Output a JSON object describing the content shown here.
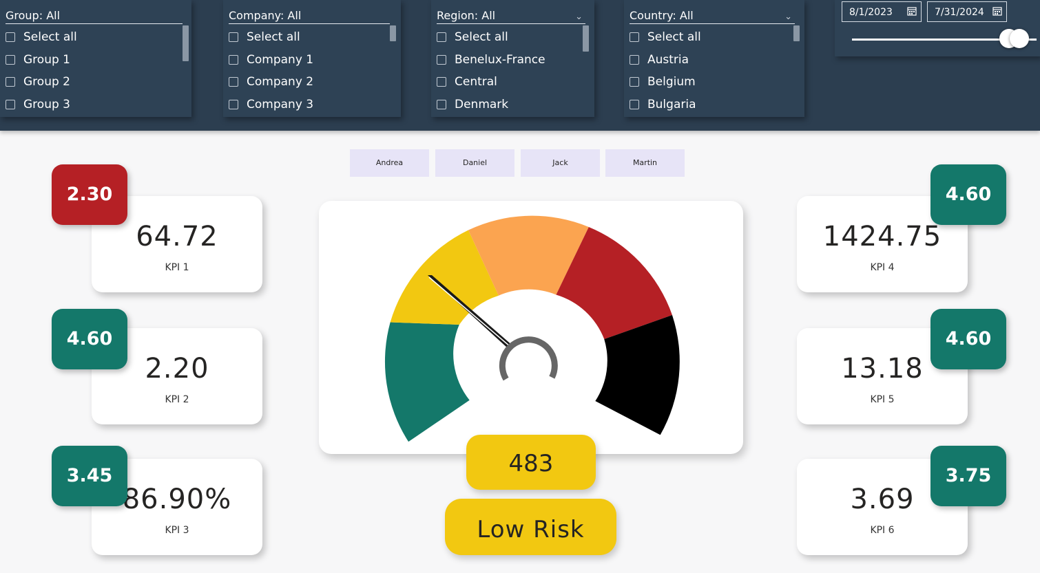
{
  "slicers": {
    "group": {
      "header": "Group: All",
      "items": [
        "Select all",
        "Group 1",
        "Group 2",
        "Group 3"
      ]
    },
    "company": {
      "header": "Company: All",
      "items": [
        "Select all",
        "Company 1",
        "Company 2",
        "Company 3"
      ]
    },
    "region": {
      "header": "Region: All",
      "items": [
        "Select all",
        "Benelux-France",
        "Central",
        "Denmark"
      ]
    },
    "country": {
      "header": "Country: All",
      "items": [
        "Select all",
        "Austria",
        "Belgium",
        "Bulgaria"
      ]
    }
  },
  "date_range": {
    "start": "8/1/2023",
    "end": "7/31/2024"
  },
  "people": [
    "Andrea",
    "Daniel",
    "Jack",
    "Martin"
  ],
  "kpis": [
    {
      "value": "64.72",
      "label": "KPI 1",
      "badge": "2.30",
      "badge_color": "#b52025"
    },
    {
      "value": "2.20",
      "label": "KPI 2",
      "badge": "4.60",
      "badge_color": "#14786a"
    },
    {
      "value": "86.90%",
      "label": "KPI 3",
      "badge": "3.45",
      "badge_color": "#14786a"
    },
    {
      "value": "1424.75",
      "label": "KPI 4",
      "badge": "4.60",
      "badge_color": "#14786a"
    },
    {
      "value": "13.18",
      "label": "KPI 5",
      "badge": "4.60",
      "badge_color": "#14786a"
    },
    {
      "value": "3.69",
      "label": "KPI 6",
      "badge": "3.75",
      "badge_color": "#14786a"
    }
  ],
  "gauge": {
    "value": "483",
    "risk_label": "Low Risk",
    "segment_colors": [
      "#14786a",
      "#f2c811",
      "#fba450",
      "#b52025",
      "#000000"
    ],
    "accent_color": "#f2c811"
  }
}
